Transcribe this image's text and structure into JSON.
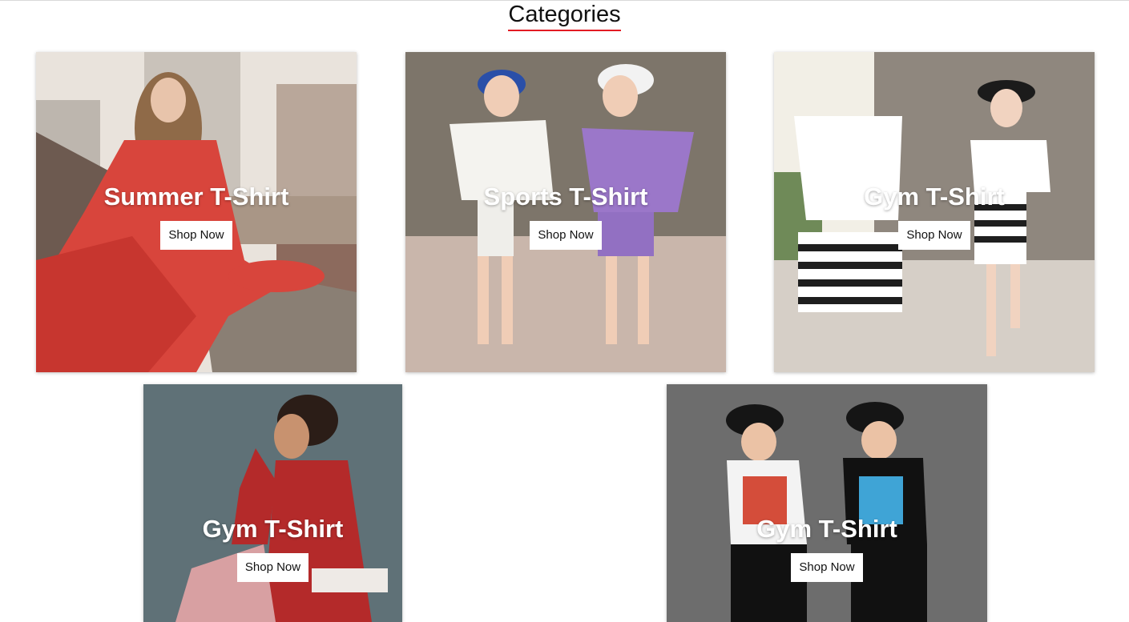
{
  "section": {
    "title": "Categories",
    "accent": "#e31b23"
  },
  "cards": [
    {
      "title": "Summer T-Shirt",
      "button": "Shop Now",
      "background": "#d8cfc6",
      "image": "woman-in-red-floral-dress-photo"
    },
    {
      "title": "Sports T-Shirt",
      "button": "Shop Now",
      "background": "#8c8479",
      "image": "two-girls-in-sports-outfits-photo"
    },
    {
      "title": "Gym T-Shirt",
      "button": "Shop Now",
      "background": "#9a938b",
      "image": "girl-in-white-top-and-striped-shorts-photo"
    },
    {
      "title": "Gym T-Shirt",
      "button": "Shop Now",
      "background": "#5f7177",
      "image": "woman-in-red-athletic-jacket-photo"
    },
    {
      "title": "Gym T-Shirt",
      "button": "Shop Now",
      "background": "#6d6d6d",
      "image": "two-boys-in-caps-and-graphic-tees-photo"
    }
  ]
}
